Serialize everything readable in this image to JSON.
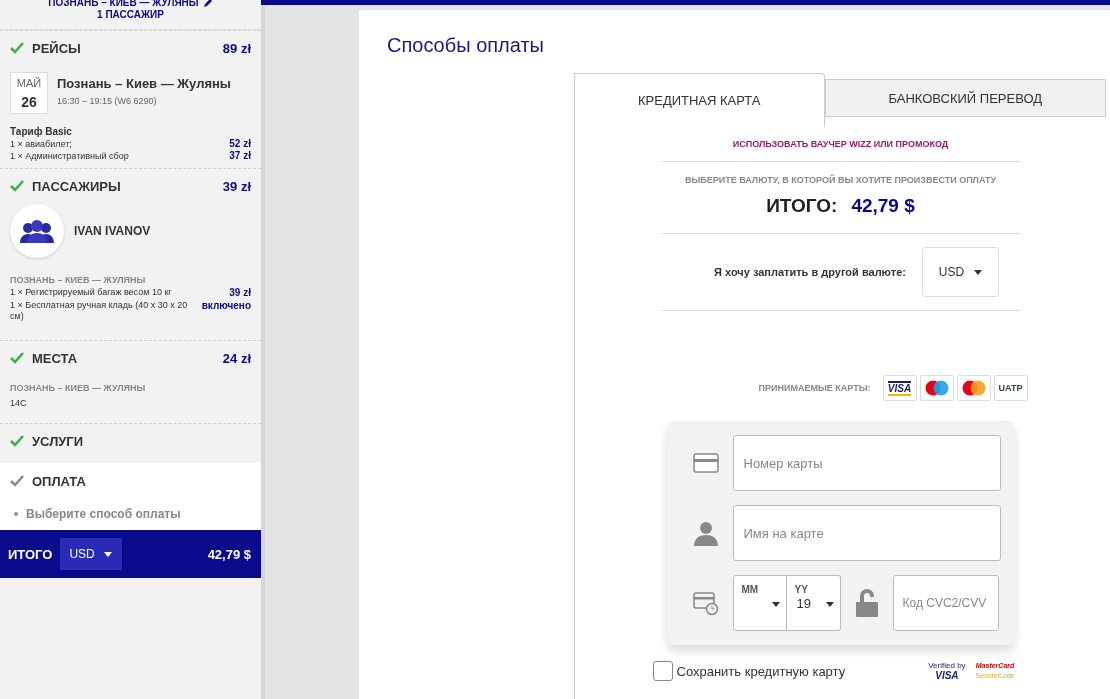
{
  "sidebar": {
    "route_header": "ПОЗНАНЬ – КИЕВ — ЖУЛЯНЫ",
    "passengers_count": "1 ПАССАЖИР",
    "sections": [
      {
        "kind": "flights",
        "title": "РЕЙСЫ",
        "price": "89 zł",
        "done": true,
        "current": false,
        "month": "МАЙ",
        "day": "26",
        "route": "Познань – Киев — Жуляны",
        "time": "16:30 – 19:15 (W6 6290)",
        "group_title": "Тариф Basic",
        "lines": [
          {
            "label": "1 × авиабилет;",
            "price": "52 zł"
          },
          {
            "label": "1 × Административный сбор",
            "price": "37 zł"
          }
        ]
      },
      {
        "kind": "passengers",
        "title": "ПАССАЖИРЫ",
        "price": "39 zł",
        "done": true,
        "current": false,
        "person": "IVAN IVANOV",
        "group_title": "ПОЗНАНЬ – КИЕВ — ЖУЛЯНЫ",
        "lines": [
          {
            "label": "1 × Регистрируемый багаж весом 10 кг",
            "price": "39 zł"
          },
          {
            "label": "1 × Бесплатная ручная кладь (40 x 30 x 20 см)",
            "price": "включено"
          }
        ]
      },
      {
        "kind": "seats",
        "title": "МЕСТА",
        "price": "24 zł",
        "done": true,
        "current": false,
        "group_title": "ПОЗНАНЬ – КИЕВ — ЖУЛЯНЫ",
        "seat": "14C"
      },
      {
        "kind": "services",
        "title": "УСЛУГИ",
        "done": true,
        "current": false
      },
      {
        "kind": "payment",
        "title": "ОПЛАТА",
        "done": false,
        "current": true,
        "hint": "Выберите способ оплаты"
      }
    ],
    "total": {
      "label": "ИТОГО",
      "currency": "USD",
      "amount": "42,79 $"
    }
  },
  "main": {
    "title": "Способы оплаты",
    "tabs": [
      {
        "label": "КРЕДИТНАЯ КАРТА",
        "selected": true
      },
      {
        "label": "БАНКОВСКИЙ ПЕРЕВОД",
        "selected": false
      }
    ],
    "voucher_link": "ИСПОЛЬЗОВАТЬ ВАУЧЕР WIZZ ИЛИ ПРОМОКОД",
    "currency_prompt": "ВЫБЕРИТЕ ВАЛЮТУ, В КОТОРОЙ ВЫ ХОТИТЕ ПРОИЗВЕСТИ ОПЛАТУ",
    "total_label": "ИТОГО:",
    "total_value": "42,79 $",
    "other_currency_label": "Я хочу заплатить в другой валюте:",
    "currency": "USD",
    "accepted_cards_label": "ПРИНИМАЕМЫЕ КАРТЫ:",
    "cards": [
      {
        "kind": "visa",
        "label": "VISA"
      },
      {
        "kind": "maestro"
      },
      {
        "kind": "mastercard"
      },
      {
        "kind": "uatp",
        "label": "UATP"
      }
    ],
    "card_number_placeholder": "Номер карты",
    "name_placeholder": "Имя на карте",
    "month_label": "MM",
    "year_label": "YY",
    "year_value": "19",
    "cvc_placeholder": "Код CVC2/CVV",
    "save_card": {
      "label": "Сохранить кредитную карту",
      "checked": false
    },
    "secure": {
      "visa_top": "Verified by",
      "visa_bottom": "VISA",
      "mc_top": "MasterCard",
      "mc_bottom": "SecureCode"
    }
  }
}
